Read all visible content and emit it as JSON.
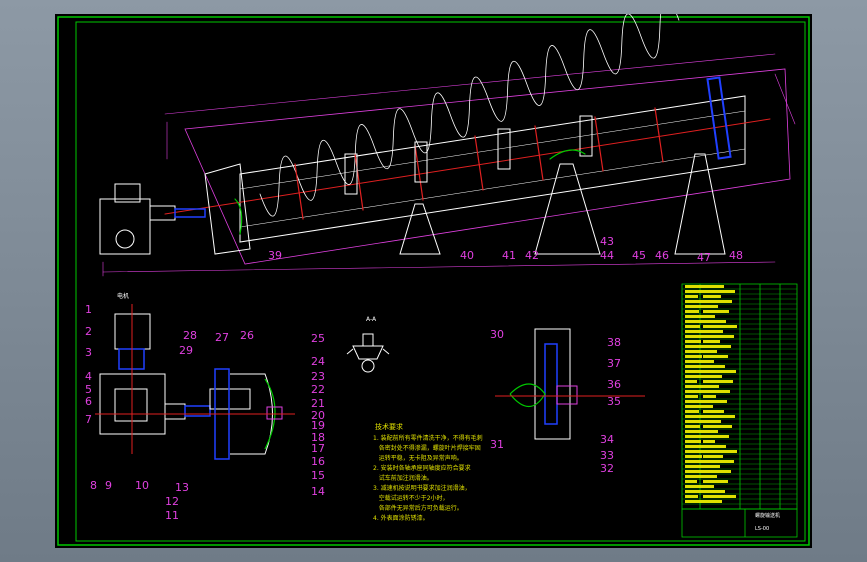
{
  "drawing": {
    "view_label_left": "电机",
    "view_label_mid": "A-A",
    "main_view_callouts": [
      "39",
      "40",
      "41",
      "42",
      "43",
      "44",
      "45",
      "46",
      "47",
      "48"
    ],
    "left_view_callouts": [
      "1",
      "2",
      "3",
      "4",
      "5",
      "6",
      "7",
      "8",
      "9",
      "10",
      "11",
      "12",
      "13"
    ],
    "flange_view_callouts": [
      "14",
      "15",
      "16",
      "17",
      "18",
      "19",
      "20",
      "21",
      "22",
      "23",
      "24",
      "25",
      "26",
      "27",
      "28",
      "29"
    ],
    "right_view_callouts": [
      "30",
      "31",
      "32",
      "33",
      "34",
      "35",
      "36",
      "37",
      "38"
    ],
    "technical_notes": {
      "heading": "技术要求",
      "lines": [
        "1. 装配前所有零件清洗干净，不得有毛刺",
        "   各密封处不得渗漏，螺旋叶片焊接牢固",
        "   运转平稳，无卡阻及异常声响。",
        "2. 安装时各轴承座同轴度应符合要求",
        "   试车前加注润滑油。",
        "3. 减速机按说明书要求加注润滑油，",
        "   空载试运转不少于2小时，",
        "   各部件无异常后方可负载运行。",
        "4. 外表面涂防锈漆。"
      ]
    },
    "title_block": {
      "name": "螺旋输送机",
      "code": "LS-00"
    }
  },
  "colors": {
    "frame": "#00c800",
    "magenta": "#e040e0",
    "white": "#ffffff",
    "red": "#e02020",
    "yellow": "#e0e000",
    "blue": "#2040ff",
    "cyan": "#00e0e0"
  }
}
